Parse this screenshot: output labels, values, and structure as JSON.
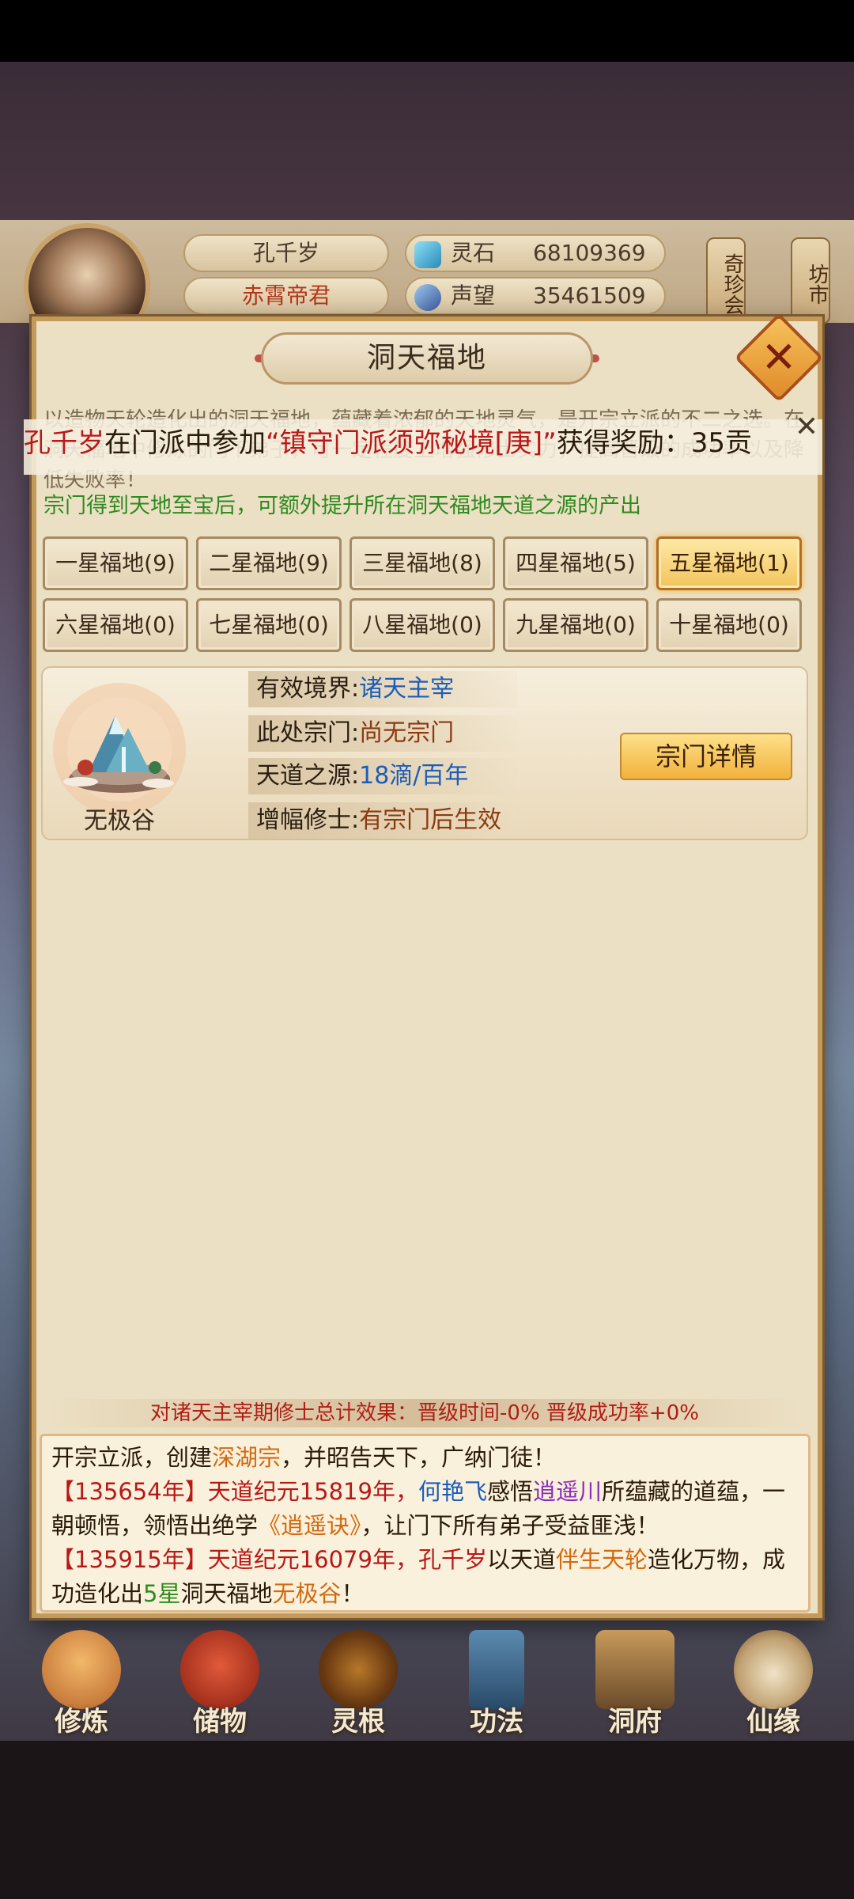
{
  "profile": {
    "name": "孔千岁",
    "title": "赤霄帝君",
    "resources": [
      {
        "label": "灵石",
        "value": "68109369",
        "icon": "spirit-stone-icon"
      },
      {
        "label": "声望",
        "value": "35461509",
        "icon": "prestige-icon"
      }
    ],
    "side_tags": [
      "奇珍会",
      "坊市"
    ]
  },
  "dialog": {
    "title": "洞天福地",
    "intro": "以造物天轮造化出的洞天福地，蕴藏着浓郁的天地灵气，是开宗立派的不二之选。在洞天福地中修炼的门下弟子，可一定程度上增强修士实力，提高晋级的成功率以及降低失败率！",
    "hint": "宗门得到天地至宝后，可额外提升所在洞天福地天道之源的产出",
    "ticker": {
      "name": "孔千岁",
      "mid": "在门派中参加",
      "event": "“镇守门派须弥秘境[庚]”",
      "tail": "获得奖励：35贡"
    },
    "tabs": [
      "一星福地(9)",
      "二星福地(9)",
      "三星福地(8)",
      "四星福地(5)",
      "五星福地(1)",
      "六星福地(0)",
      "七星福地(0)",
      "八星福地(0)",
      "九星福地(0)",
      "十星福地(0)"
    ],
    "active_tab": 4,
    "fudi": {
      "name": "无极谷",
      "rows": [
        {
          "key": "有效境界:",
          "value": "诸天主宰"
        },
        {
          "key": "此处宗门:",
          "value": "尚无宗门"
        },
        {
          "key": "天道之源:",
          "value": "18滴/百年"
        },
        {
          "key": "增幅修士:",
          "value": "有宗门后生效"
        }
      ],
      "detail_button": "宗门详情"
    },
    "effect": "对诸天主宰期修士总计效果：晋级时间-0% 晋级成功率+0%",
    "log": {
      "l1a": "开宗立派，创建",
      "l1b": "深湖宗",
      "l1c": "，并昭告天下，广纳门徒！",
      "l2a": "【135654年】天道纪元15819年，",
      "l2b": "何艳飞",
      "l2c": "感悟",
      "l2d": "逍遥川",
      "l2e": "所蕴藏的道蕴，一朝顿悟，领悟出绝学",
      "l2f": "《逍遥诀》",
      "l2g": "，让门下所有弟子受益匪浅！",
      "l3a": "【135915年】天道纪元16079年，",
      "l3b": "孔千岁",
      "l3c": "以天道",
      "l3d": "伴生天轮",
      "l3e": "造化万物，成功造化出",
      "l3f": "5星",
      "l3g": "洞天福地",
      "l3h": "无极谷",
      "l3i": "！"
    }
  },
  "nav": [
    "修炼",
    "储物",
    "灵根",
    "功法",
    "洞府",
    "仙缘"
  ],
  "colors": {
    "accent_gold": "#f2c45c",
    "text_red": "#b81818",
    "text_green": "#2e8a1e",
    "text_blue": "#1d5db8"
  }
}
